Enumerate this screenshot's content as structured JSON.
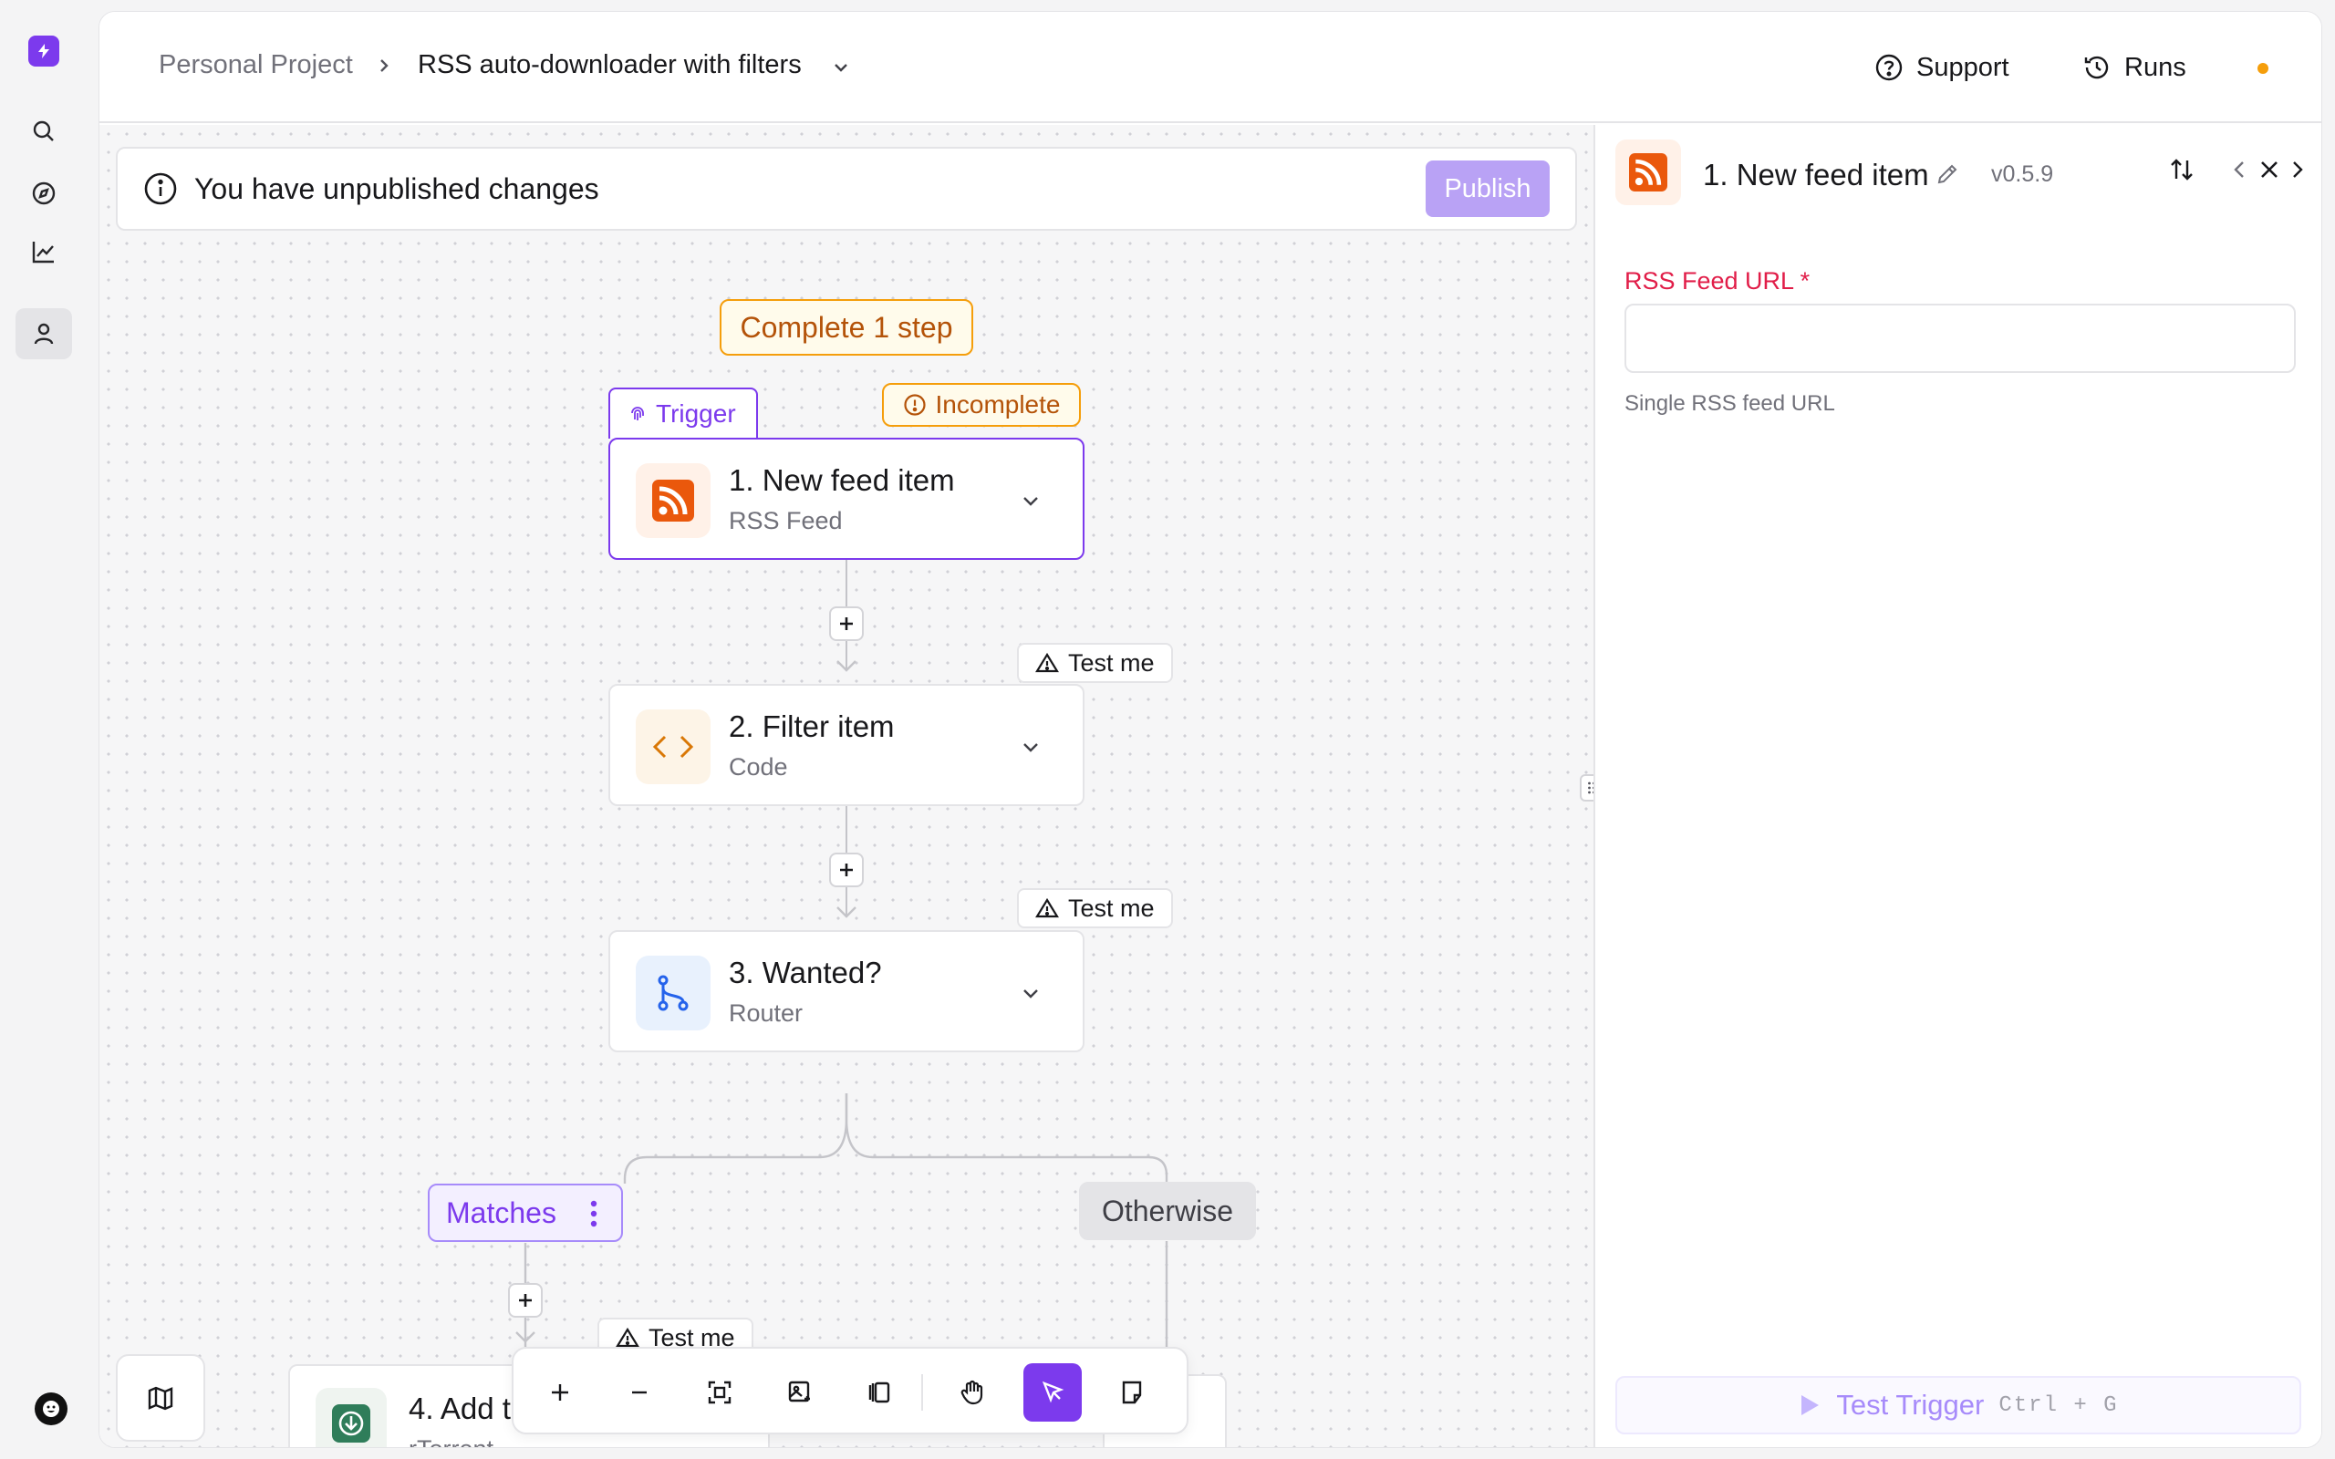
{
  "breadcrumb": {
    "project": "Personal Project",
    "flow_name": "RSS auto-downloader with filters"
  },
  "header": {
    "support_label": "Support",
    "runs_label": "Runs"
  },
  "banner": {
    "message": "You have unpublished changes",
    "publish_label": "Publish"
  },
  "canvas": {
    "complete_label": "Complete 1 step",
    "trigger_tag": "Trigger",
    "incomplete_tag": "Incomplete",
    "test_me_label": "Test me",
    "steps": [
      {
        "title": "1. New feed item",
        "subtitle": "RSS Feed"
      },
      {
        "title": "2. Filter item",
        "subtitle": "Code"
      },
      {
        "title": "3. Wanted?",
        "subtitle": "Router"
      },
      {
        "title": "4. Add t",
        "subtitle": "rTorrent"
      }
    ],
    "branches": {
      "matches": "Matches",
      "otherwise": "Otherwise"
    }
  },
  "panel": {
    "title": "1. New feed item",
    "version": "v0.5.9",
    "field_label": "RSS Feed URL *",
    "field_value": "",
    "field_help": "Single RSS feed URL",
    "test_trigger_label": "Test Trigger",
    "test_trigger_shortcut": "Ctrl + G"
  },
  "colors": {
    "accent": "#7c3aed",
    "warning": "#f59e0b",
    "required": "#e11d48",
    "rss": "#ea580c"
  },
  "icons": [
    "bolt-logo-icon",
    "search-icon",
    "compass-icon",
    "chart-icon",
    "user-icon",
    "help-circle-icon",
    "history-icon",
    "info-icon",
    "rss-icon",
    "code-icon",
    "router-icon",
    "download-icon",
    "plus-icon",
    "minus-icon",
    "fit-icon",
    "image-icon",
    "panel-icon",
    "hand-icon",
    "pointer-icon",
    "note-icon",
    "map-icon",
    "pencil-icon",
    "swap-icon",
    "chevron-left-icon",
    "chevron-right-icon",
    "close-icon",
    "play-icon"
  ]
}
